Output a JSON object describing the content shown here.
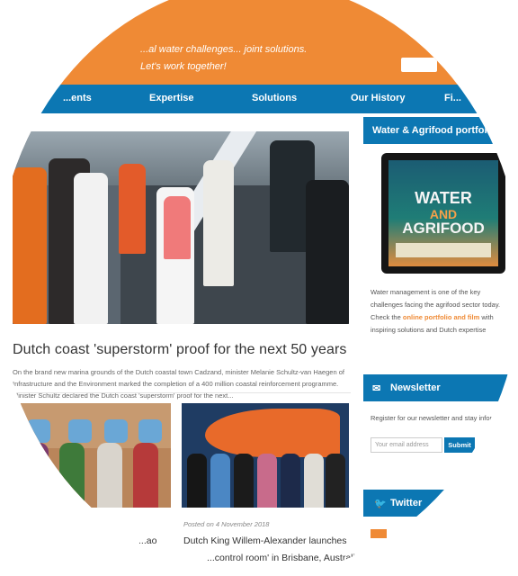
{
  "header": {
    "tagline_line1": "...al water challenges... joint solutions.",
    "tagline_line2": "Let's work together!"
  },
  "nav": {
    "items": [
      "...ents",
      "Expertise",
      "Solutions",
      "Our History",
      "Fi..."
    ]
  },
  "featured": {
    "title": "Dutch coast 'superstorm' proof for the next 50 years",
    "excerpt": "On the brand new marina grounds of the Dutch coastal town Cadzand, minister Melanie Schultz-van Haegen of Infrastructure and the Environment marked the completion of a 400 million coastal reinforcement programme. Minister Schultz declared the Dutch coast 'superstorm' proof for the next..."
  },
  "articles": [
    {
      "title_fragment": "...ao"
    },
    {
      "meta": "Posted on 4 November 2018",
      "title_line1": "Dutch King Willem-Alexander launches",
      "title_line2": "...control room' in Brisbane, Australi..."
    }
  ],
  "sidebar": {
    "portfolio": {
      "heading": "Water & Agrifood portfolio",
      "tablet_words": [
        "WATER",
        "AND",
        "AGRIFOOD"
      ],
      "text_before": "Water management is one of the key challenges facing the agrifood sector today. Check the ",
      "link": "online portfolio and film",
      "text_after": " with inspiring solutions and Dutch expertise"
    },
    "newsletter": {
      "icon": "envelope-icon",
      "heading": "Newsletter",
      "text": "Register for our newsletter and stay informed!",
      "email_placeholder": "Your email address",
      "submit_label": "Submit"
    },
    "twitter": {
      "icon": "twitter-icon",
      "heading": "Twitter"
    }
  },
  "colors": {
    "accent_orange": "#ef8a35",
    "brand_blue": "#0c77b3"
  }
}
